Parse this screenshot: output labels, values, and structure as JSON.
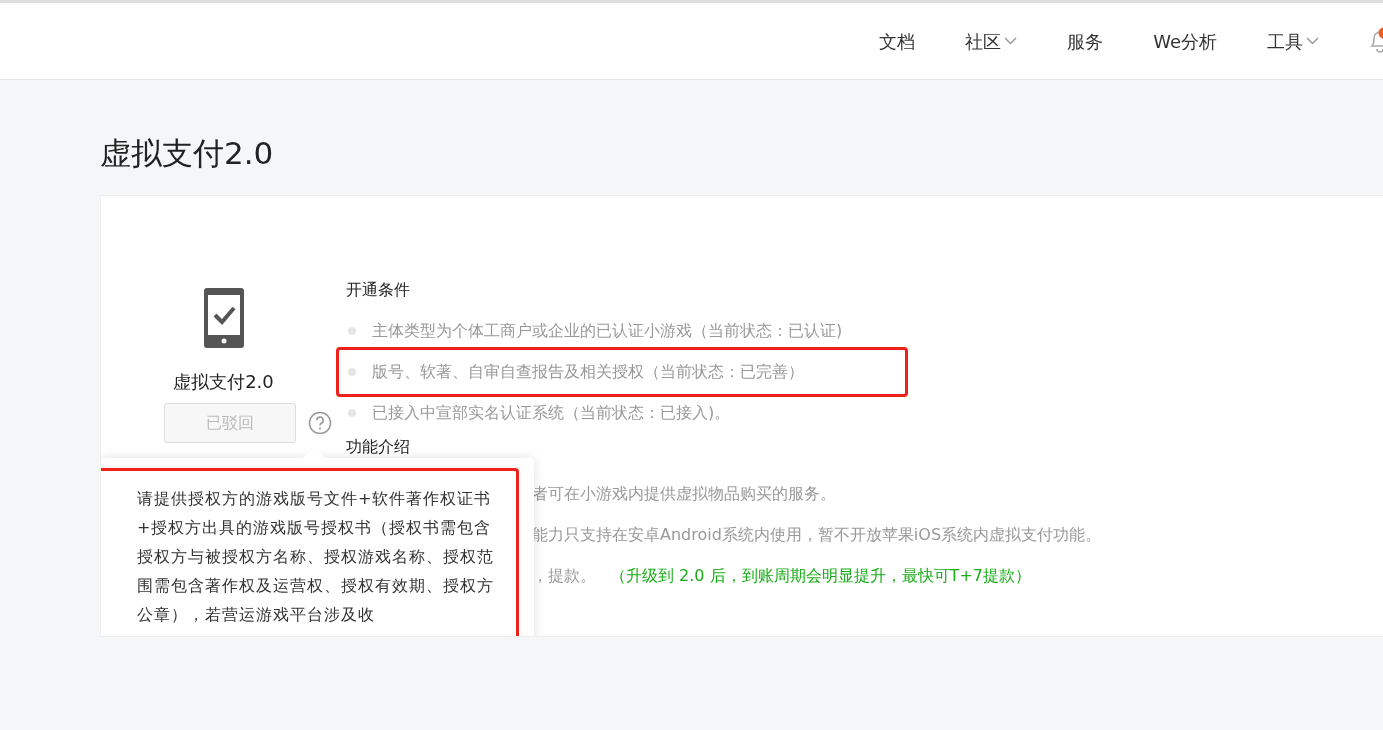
{
  "nav": {
    "items": [
      {
        "label": "文档",
        "dropdown": false
      },
      {
        "label": "社区",
        "dropdown": true
      },
      {
        "label": "服务",
        "dropdown": false
      },
      {
        "label": "We分析",
        "dropdown": false
      },
      {
        "label": "工具",
        "dropdown": true
      }
    ],
    "notification_badge": true
  },
  "page_title": "虚拟支付2.0",
  "feature": {
    "name": "虚拟支付2.0",
    "status_button": {
      "label": "已驳回",
      "disabled": true
    }
  },
  "conditions": {
    "heading": "开通条件",
    "items": [
      {
        "text": "主体类型为个体工商户或企业的已认证小游戏（当前状态：已认证)",
        "highlighted": false
      },
      {
        "text": "版号、软著、自审自查报告及相关授权（当前状态：已完善）",
        "highlighted": true
      },
      {
        "text": "已接入中宣部实名认证系统（当前状态：已接入)。",
        "highlighted": false
      }
    ]
  },
  "intro": {
    "heading": "功能介绍",
    "lines": [
      {
        "text": "者可在小游戏内提供虚拟物品购买的服务。"
      },
      {
        "text": "能力只支持在安卓Android系统内使用，暂不开放苹果iOS系统内虚拟支付功能。"
      },
      {
        "text": "，提款。",
        "note": "（升级到 2.0 后，到账周期会明显提升，最快可T+7提款）"
      }
    ]
  },
  "tooltip": {
    "highlighted": true,
    "text": "请提供授权方的游戏版号文件+软件著作权证书+授权方出具的游戏版号授权书（授权书需包含授权方与被授权方名称、授权游戏名称、授权范围需包含著作权及运营权、授权有效期、授权方公章），若营运游戏平台涉及收"
  }
}
